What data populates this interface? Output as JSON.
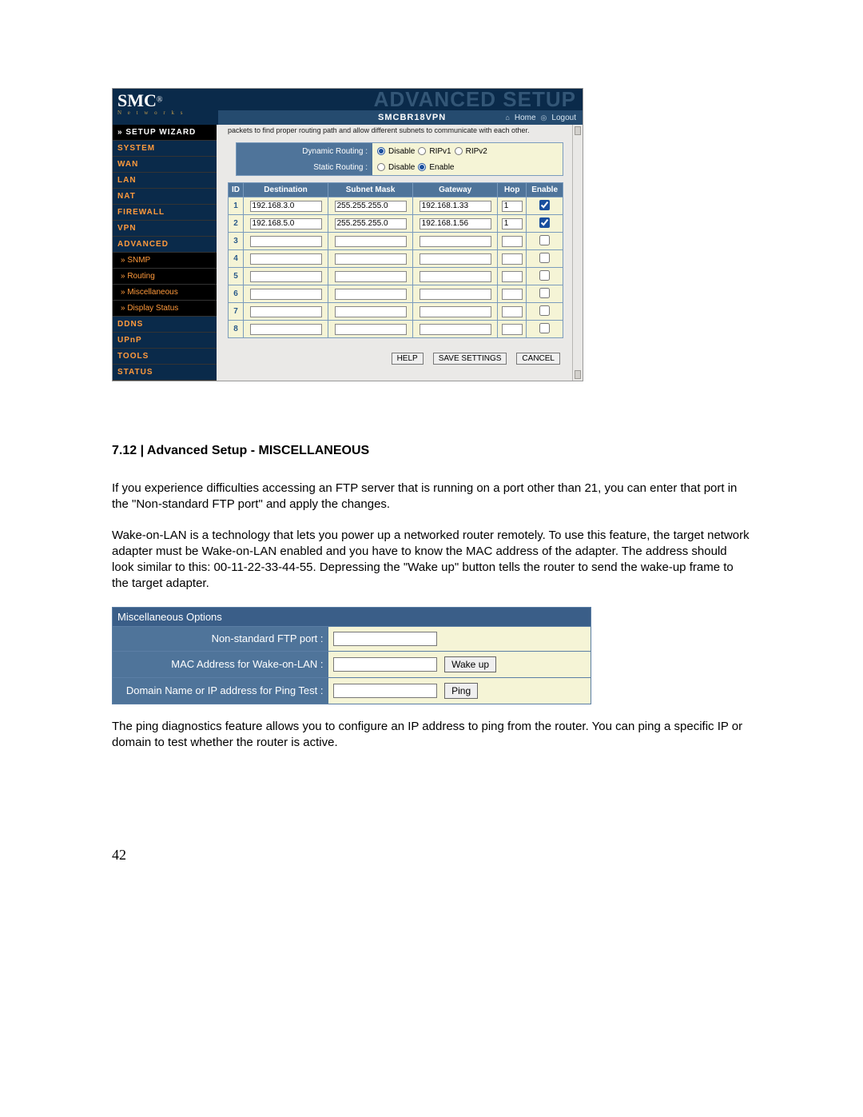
{
  "logo": {
    "brand": "SMC",
    "reg": "®",
    "sub": "N e t w o r k s"
  },
  "banner": {
    "adv": "ADVANCED SETUP",
    "model": "SMCBR18VPN",
    "home": "Home",
    "logout": "Logout"
  },
  "nav": {
    "wizard": "» SETUP WIZARD",
    "items": [
      "SYSTEM",
      "WAN",
      "LAN",
      "NAT",
      "FIREWALL",
      "VPN",
      "ADVANCED"
    ],
    "subs": [
      "» SNMP",
      "» Routing",
      "» Miscellaneous",
      "» Display Status"
    ],
    "items2": [
      "DDNS",
      "UPnP",
      "TOOLS",
      "STATUS"
    ]
  },
  "cutoff": "packets to find proper routing path and allow different subnets to communicate with each other.",
  "routing": {
    "dyn_label": "Dynamic Routing :",
    "dyn_opts": [
      "Disable",
      "RIPv1",
      "RIPv2"
    ],
    "dyn_sel": 0,
    "stat_label": "Static Routing :",
    "stat_opts": [
      "Disable",
      "Enable"
    ],
    "stat_sel": 1
  },
  "rt_headers": [
    "ID",
    "Destination",
    "Subnet Mask",
    "Gateway",
    "Hop",
    "Enable"
  ],
  "rt_rows": [
    {
      "id": "1",
      "dest": "192.168.3.0",
      "mask": "255.255.255.0",
      "gw": "192.168.1.33",
      "hop": "1",
      "en": true
    },
    {
      "id": "2",
      "dest": "192.168.5.0",
      "mask": "255.255.255.0",
      "gw": "192.168.1.56",
      "hop": "1",
      "en": true
    },
    {
      "id": "3",
      "dest": "",
      "mask": "",
      "gw": "",
      "hop": "",
      "en": false
    },
    {
      "id": "4",
      "dest": "",
      "mask": "",
      "gw": "",
      "hop": "",
      "en": false
    },
    {
      "id": "5",
      "dest": "",
      "mask": "",
      "gw": "",
      "hop": "",
      "en": false
    },
    {
      "id": "6",
      "dest": "",
      "mask": "",
      "gw": "",
      "hop": "",
      "en": false
    },
    {
      "id": "7",
      "dest": "",
      "mask": "",
      "gw": "",
      "hop": "",
      "en": false
    },
    {
      "id": "8",
      "dest": "",
      "mask": "",
      "gw": "",
      "hop": "",
      "en": false
    }
  ],
  "buttons": {
    "help": "HELP",
    "save": "SAVE SETTINGS",
    "cancel": "CANCEL"
  },
  "doc": {
    "heading": "7.12 | Advanced Setup - MISCELLANEOUS",
    "p1": "If you experience difficulties accessing an FTP server that is running on a port other than 21, you can enter that port in the \"Non-standard FTP port\" and apply the changes.",
    "p2": "Wake-on-LAN is a technology that lets you power up a networked router remotely. To use this feature, the target network adapter must be Wake-on-LAN enabled and you have to know the MAC address of the adapter. The address should look similar to this: 00-11-22-33-44-55. Depressing the \"Wake up\" button tells the router to send the wake-up frame to the target adapter.",
    "p3": "The ping diagnostics feature allows you to configure an IP address to ping from the router. You can ping a specific IP or domain to test whether the router is active."
  },
  "misc": {
    "title": "Miscellaneous Options",
    "ftp_label": "Non-standard FTP port :",
    "wol_label": "MAC Address for Wake-on-LAN :",
    "wol_btn": "Wake up",
    "ping_label": "Domain Name or IP address for Ping Test :",
    "ping_btn": "Ping"
  },
  "pagenum": "42"
}
